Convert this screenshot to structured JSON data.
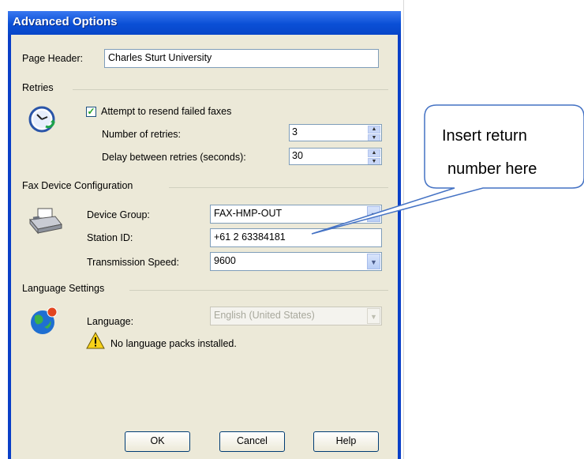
{
  "dialog": {
    "title": "Advanced Options"
  },
  "page_header": {
    "label": "Page Header:",
    "value": "Charles Sturt University"
  },
  "retries": {
    "section": "Retries",
    "checkbox_label": "Attempt to resend failed faxes",
    "checked": true,
    "num_label": "Number of retries:",
    "num_value": "3",
    "delay_label": "Delay between retries (seconds):",
    "delay_value": "30"
  },
  "fax_device": {
    "section": "Fax Device Configuration",
    "group_label": "Device Group:",
    "group_value": "FAX-HMP-OUT",
    "station_label": "Station ID:",
    "station_value": "+61 2 63384181",
    "speed_label": "Transmission Speed:",
    "speed_value": "9600"
  },
  "language": {
    "section": "Language Settings",
    "label": "Language:",
    "value": "English (United States)",
    "warning": "No language packs installed."
  },
  "buttons": {
    "ok": "OK",
    "cancel": "Cancel",
    "help": "Help"
  },
  "callout": {
    "line1": "Insert return",
    "line2": "number here"
  },
  "colors": {
    "titlebar": "#0a4fd6",
    "dialog_bg": "#ece9d8",
    "callout_stroke": "#4472c4"
  }
}
